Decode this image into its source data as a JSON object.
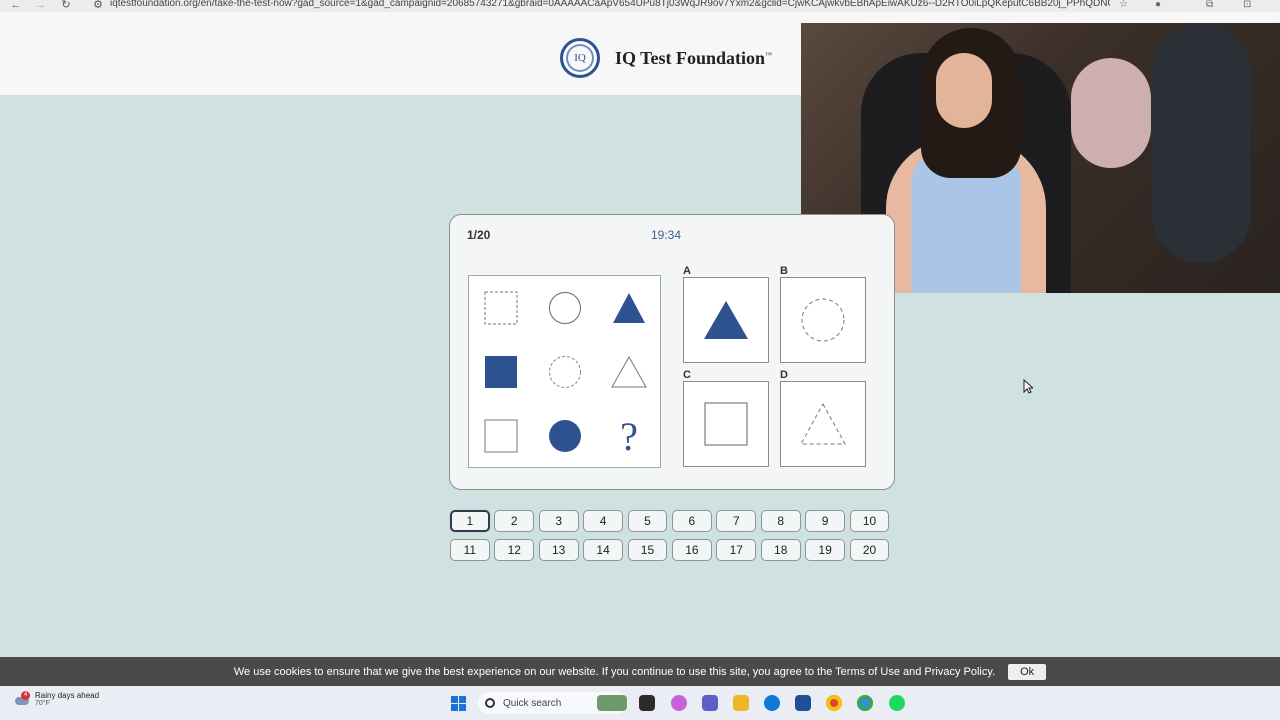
{
  "browser": {
    "url": "iqtestfoundation.org/en/take-the-test-now?gad_source=1&gad_campaignid=20685743271&gbraid=0AAAAACaApV654UPu8Tj03WqJR9ov7Yxm2&gclid=CjwKCAjwkvbEBhApEiwAKUz6--D2RTO0iLpQKeputC6BB20j_PPhQDNOugb..."
  },
  "site": {
    "logo_mark": "IQ",
    "name": "IQ Test Foundation",
    "trademark": "™"
  },
  "quiz": {
    "progress": "1/20",
    "timer": "19:34",
    "question_mark": "?",
    "options": [
      {
        "letter": "A",
        "shape": "filled-triangle"
      },
      {
        "letter": "B",
        "shape": "dashed-circle"
      },
      {
        "letter": "C",
        "shape": "outline-square"
      },
      {
        "letter": "D",
        "shape": "dashed-triangle"
      }
    ]
  },
  "pagination": {
    "row1": [
      "1",
      "2",
      "3",
      "4",
      "5",
      "6",
      "7",
      "8",
      "9",
      "10"
    ],
    "row2": [
      "11",
      "12",
      "13",
      "14",
      "15",
      "16",
      "17",
      "18",
      "19",
      "20"
    ],
    "current": "1"
  },
  "cookie": {
    "text": "We use cookies to ensure that we give the best experience on our website. If you continue to use this site, you agree to the Terms of Use and Privacy Policy.",
    "ok": "Ok"
  },
  "taskbar": {
    "weather_badge": "4",
    "weather_title": "Rainy days ahead",
    "weather_temp": "70°F",
    "search_placeholder": "Quick search"
  },
  "colors": {
    "accent": "#2e5190",
    "page_bg": "#cfe1e0",
    "cookie_bg": "#4a4a4a"
  }
}
